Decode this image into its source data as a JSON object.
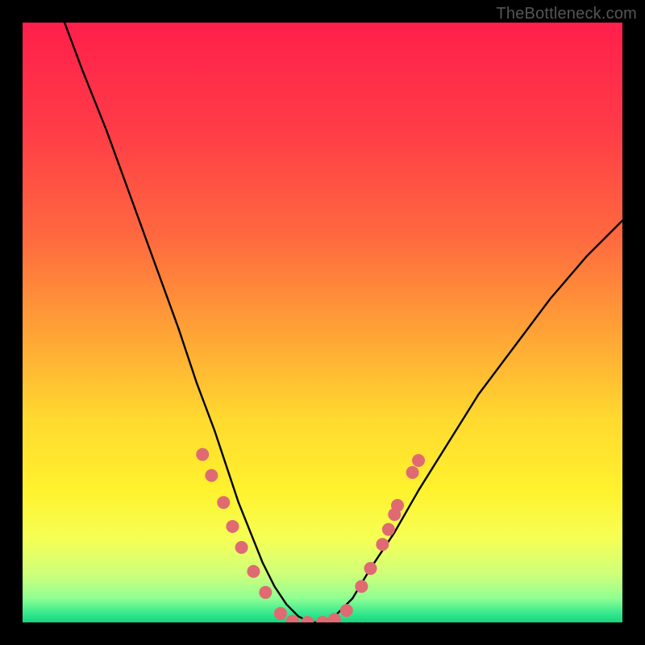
{
  "watermark": "TheBottleneck.com",
  "gradient": {
    "stops": [
      {
        "offset": 0.0,
        "color": "#ff1f4b"
      },
      {
        "offset": 0.18,
        "color": "#ff3c47"
      },
      {
        "offset": 0.36,
        "color": "#ff6a3f"
      },
      {
        "offset": 0.52,
        "color": "#ffa436"
      },
      {
        "offset": 0.66,
        "color": "#ffd92f"
      },
      {
        "offset": 0.78,
        "color": "#fff22e"
      },
      {
        "offset": 0.86,
        "color": "#f6ff55"
      },
      {
        "offset": 0.92,
        "color": "#ceff7a"
      },
      {
        "offset": 0.96,
        "color": "#8fff93"
      },
      {
        "offset": 0.985,
        "color": "#35e88e"
      },
      {
        "offset": 1.0,
        "color": "#17d47e"
      }
    ]
  },
  "chart_data": {
    "type": "line",
    "title": "",
    "xlabel": "",
    "ylabel": "",
    "x_range": [
      0,
      100
    ],
    "y_range": [
      0,
      100
    ],
    "series": [
      {
        "name": "bottleneck-curve",
        "x": [
          7,
          10,
          14,
          18,
          22,
          26,
          29,
          32,
          34,
          36,
          38,
          40,
          42,
          44,
          46,
          48,
          50,
          52,
          55,
          58,
          62,
          66,
          71,
          76,
          82,
          88,
          94,
          100
        ],
        "y": [
          100,
          92,
          82,
          71,
          60,
          49,
          40,
          32,
          26,
          20,
          15,
          10,
          6,
          3,
          1,
          0,
          0,
          1,
          4,
          9,
          15,
          22,
          30,
          38,
          46,
          54,
          61,
          67
        ]
      }
    ],
    "markers": {
      "name": "highlight-points",
      "color": "#e06a72",
      "radius_px": 8,
      "points": [
        {
          "x": 30.0,
          "y": 28.0
        },
        {
          "x": 31.5,
          "y": 24.5
        },
        {
          "x": 33.5,
          "y": 20.0
        },
        {
          "x": 35.0,
          "y": 16.0
        },
        {
          "x": 36.5,
          "y": 12.5
        },
        {
          "x": 38.5,
          "y": 8.5
        },
        {
          "x": 40.5,
          "y": 5.0
        },
        {
          "x": 43.0,
          "y": 1.5
        },
        {
          "x": 45.0,
          "y": 0.2
        },
        {
          "x": 47.5,
          "y": 0.0
        },
        {
          "x": 50.0,
          "y": 0.0
        },
        {
          "x": 52.0,
          "y": 0.5
        },
        {
          "x": 54.0,
          "y": 2.0
        },
        {
          "x": 56.5,
          "y": 6.0
        },
        {
          "x": 58.0,
          "y": 9.0
        },
        {
          "x": 60.0,
          "y": 13.0
        },
        {
          "x": 61.0,
          "y": 15.5
        },
        {
          "x": 62.0,
          "y": 18.0
        },
        {
          "x": 62.5,
          "y": 19.5
        },
        {
          "x": 65.0,
          "y": 25.0
        },
        {
          "x": 66.0,
          "y": 27.0
        }
      ]
    }
  }
}
